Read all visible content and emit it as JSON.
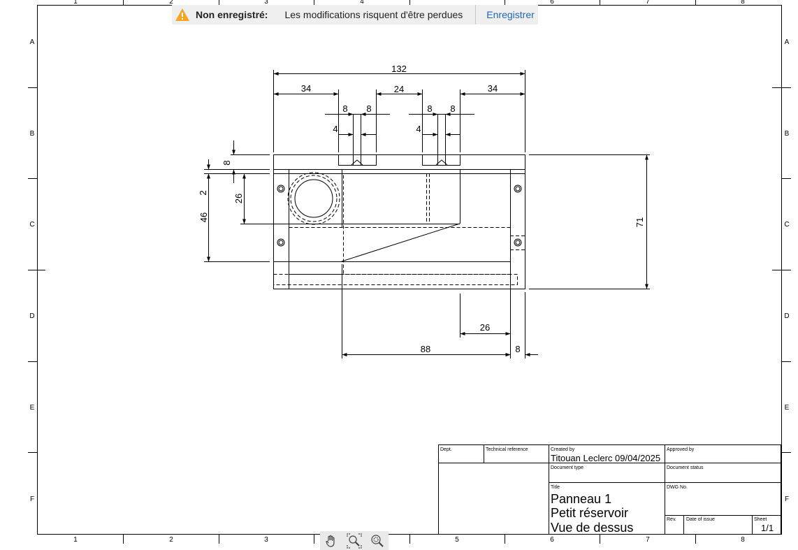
{
  "notification": {
    "warning_icon": "warning-triangle-icon",
    "warning_color": "#f5a623",
    "title": "Non enregistré:",
    "message": "Les modifications risquent d'être perdues",
    "button": "Enregistrer",
    "button_color": "#1f66b5"
  },
  "frame": {
    "columns": [
      "1",
      "2",
      "3",
      "4",
      "5",
      "6",
      "7",
      "8"
    ],
    "rows": [
      "A",
      "B",
      "C",
      "D",
      "E",
      "F"
    ]
  },
  "dimensions": {
    "d132": "132",
    "d34a": "34",
    "d24": "24",
    "d34b": "34",
    "d8a": "8",
    "d8b": "8",
    "d8c": "8",
    "d8d": "8",
    "d4a": "4",
    "d4b": "4",
    "d8e": "8",
    "d2": "2",
    "d26a": "26",
    "d46": "46",
    "d71": "71",
    "d26b": "26",
    "d88": "88",
    "d8f": "8"
  },
  "title_block": {
    "dept_label": "Dept.",
    "techref_label": "Technical reference",
    "created_label": "Created by",
    "created_value": "Titouan Leclerc 09/04/2025",
    "approved_label": "Approved by",
    "doctype_label": "Document type",
    "docstatus_label": "Document status",
    "title_label": "Title",
    "title_line1": "Panneau 1",
    "title_line2": "Petit réservoir",
    "title_line3": "Vue de dessus",
    "dwg_label": "DWG No.",
    "rev_label": "Rev.",
    "date_label": "Date of issue",
    "sheet_label": "Sheet",
    "sheet_value": "1/1"
  },
  "toolbar": {
    "tools": [
      "pan-hand-icon",
      "zoom-icon",
      "zoom-fit-icon"
    ]
  }
}
